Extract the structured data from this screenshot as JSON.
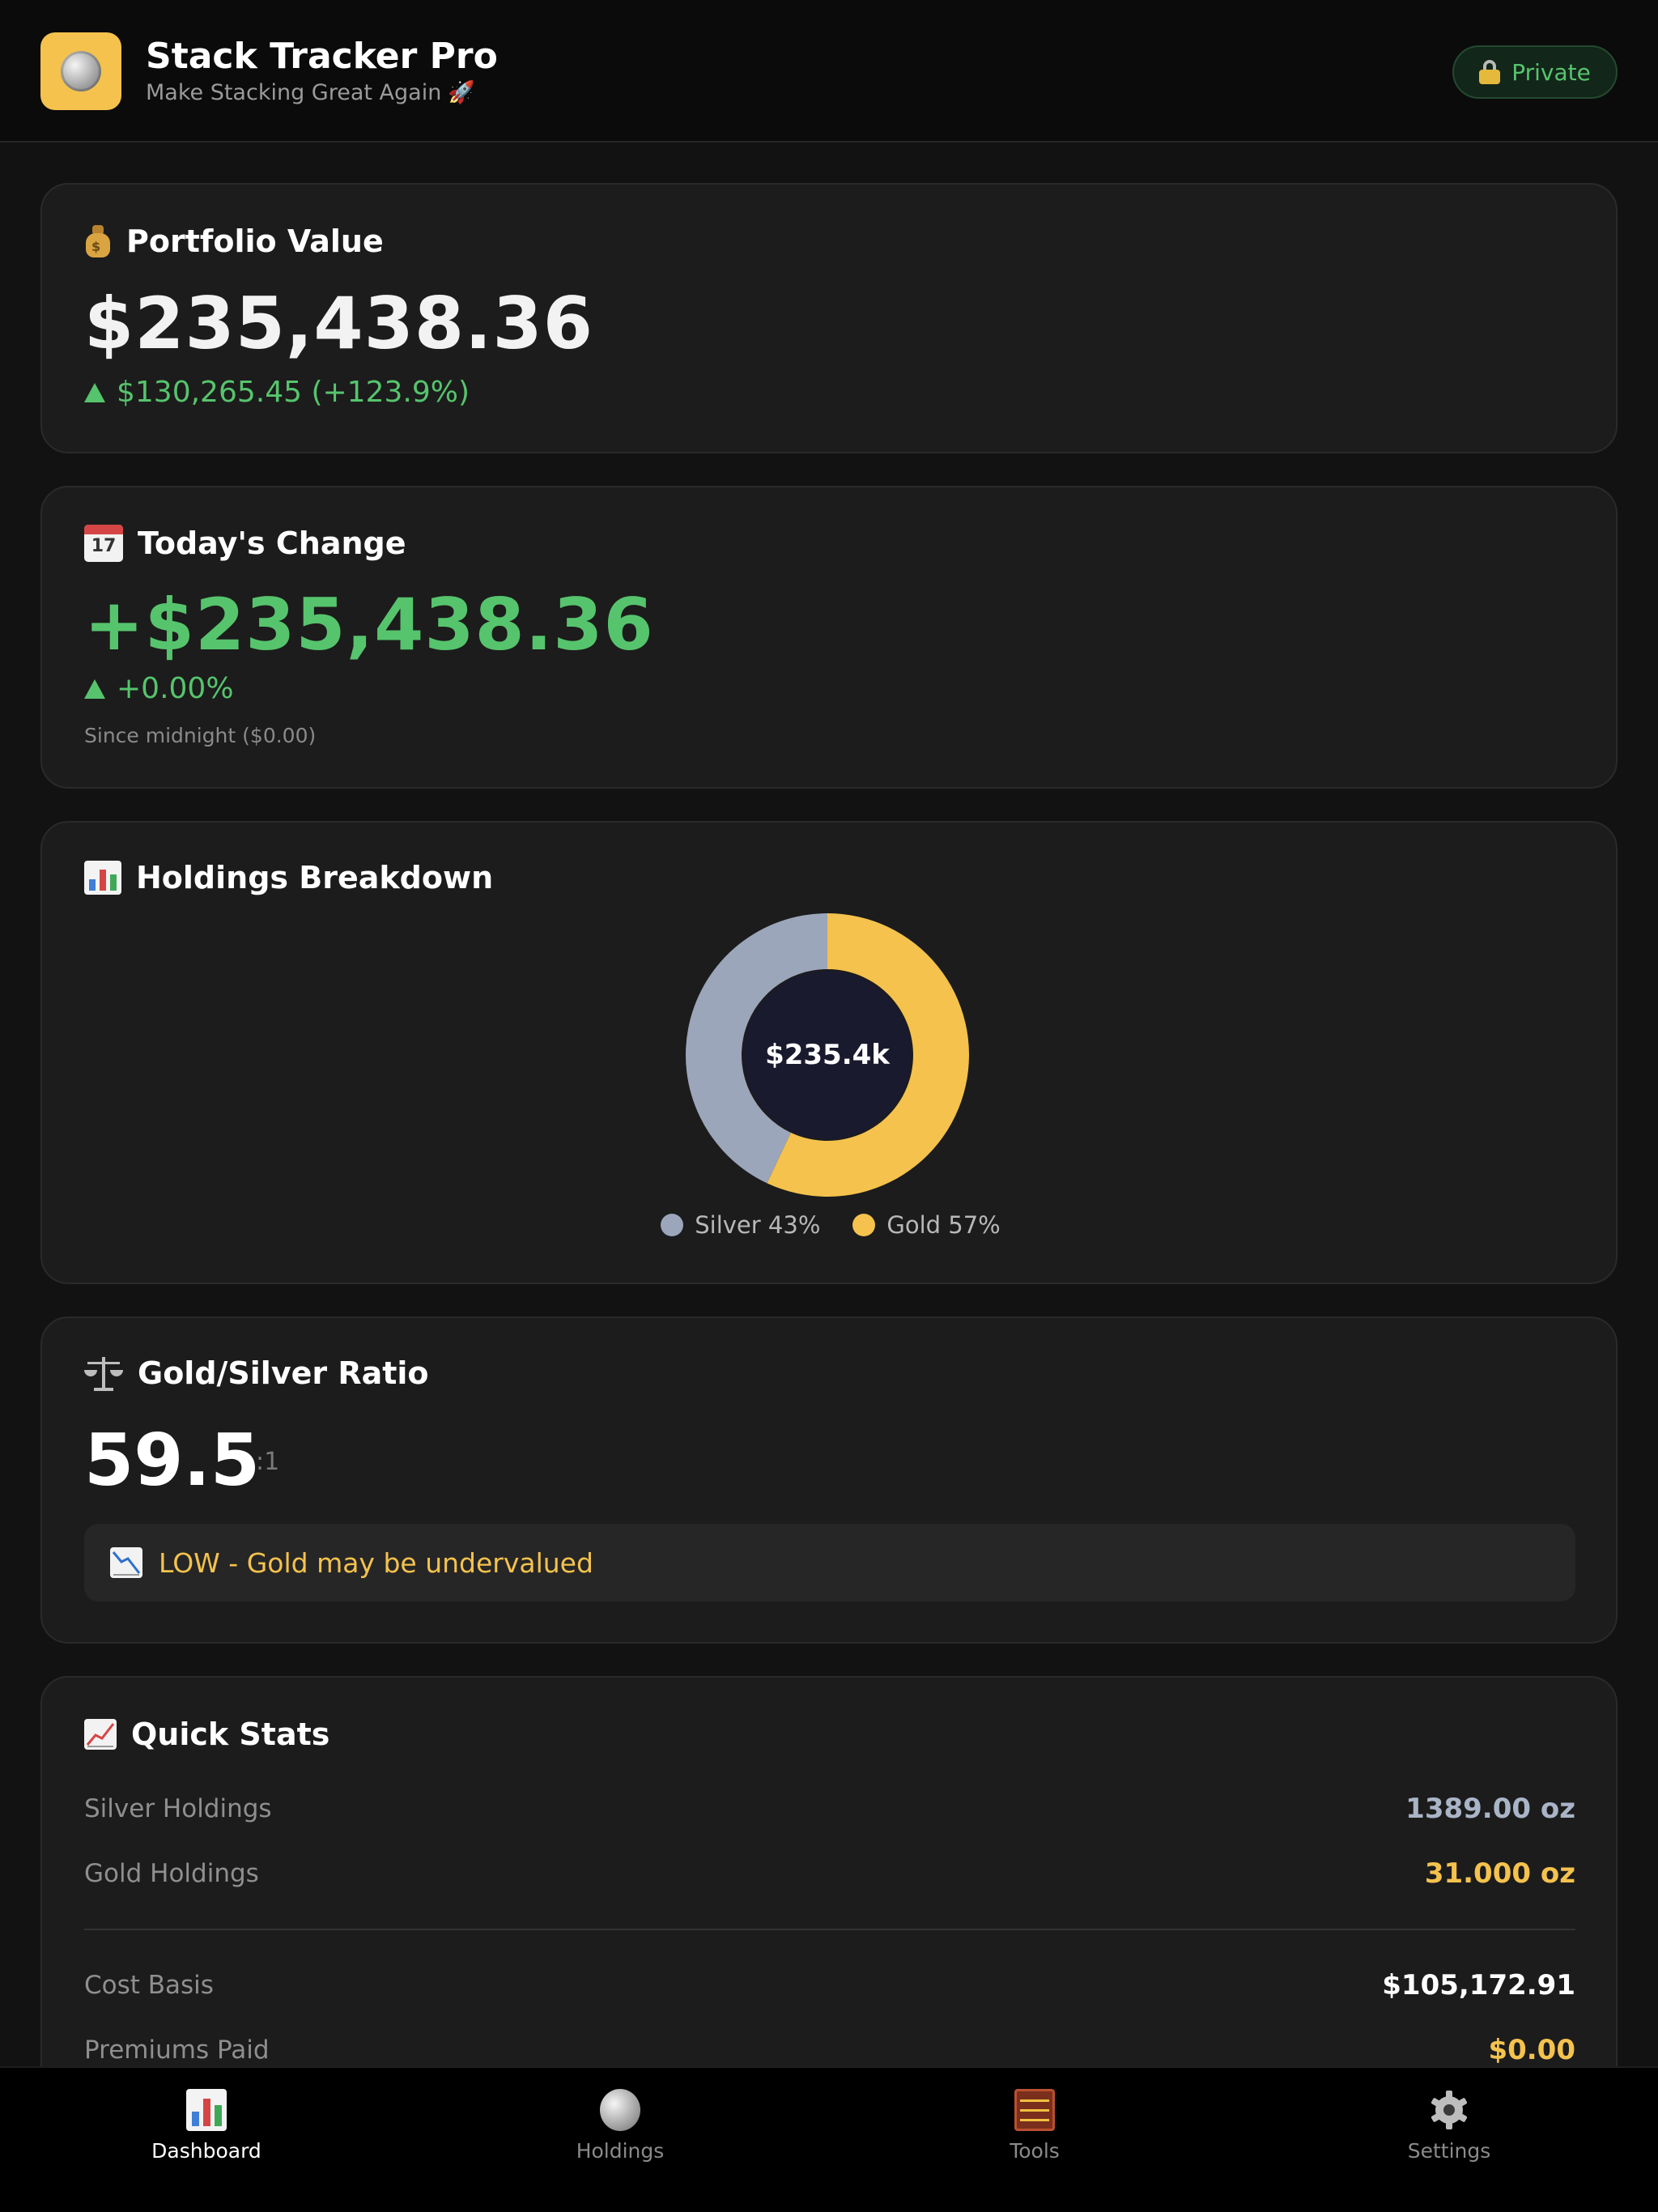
{
  "header": {
    "title": "Stack Tracker Pro",
    "subtitle": "Make Stacking Great Again",
    "private_label": "Private"
  },
  "portfolio": {
    "title": "Portfolio Value",
    "value": "$235,438.36",
    "change": "$130,265.45 (+123.9%)"
  },
  "today": {
    "title": "Today's Change",
    "value": "+$235,438.36",
    "percent": "+0.00%",
    "note": "Since midnight ($0.00)",
    "calendar_day": "17"
  },
  "holdings": {
    "title": "Holdings Breakdown",
    "center_label": "$235.4k",
    "chart_data": {
      "type": "pie",
      "categories": [
        "Silver",
        "Gold"
      ],
      "values": [
        43,
        57
      ],
      "legend": [
        "Silver 43%",
        "Gold 57%"
      ],
      "colors": [
        "#9ba6ba",
        "#f4c24d"
      ],
      "legend_position": "bottom"
    }
  },
  "ratio": {
    "title": "Gold/Silver Ratio",
    "value": "59.5",
    "unit": ":1",
    "note": "LOW - Gold may be undervalued"
  },
  "quick_stats": {
    "title": "Quick Stats",
    "rows": [
      {
        "label": "Silver Holdings",
        "value": "1389.00 oz"
      },
      {
        "label": "Gold Holdings",
        "value": "31.000 oz"
      },
      {
        "label": "Cost Basis",
        "value": "$105,172.91"
      },
      {
        "label": "Premiums Paid",
        "value": "$0.00"
      }
    ]
  },
  "nav": {
    "items": [
      {
        "label": "Dashboard"
      },
      {
        "label": "Holdings"
      },
      {
        "label": "Tools"
      },
      {
        "label": "Settings"
      }
    ]
  },
  "colors": {
    "accent_green": "#56c46d",
    "gold": "#f4c24d",
    "silver": "#9ba6ba",
    "card_bg": "#1c1c1c"
  }
}
